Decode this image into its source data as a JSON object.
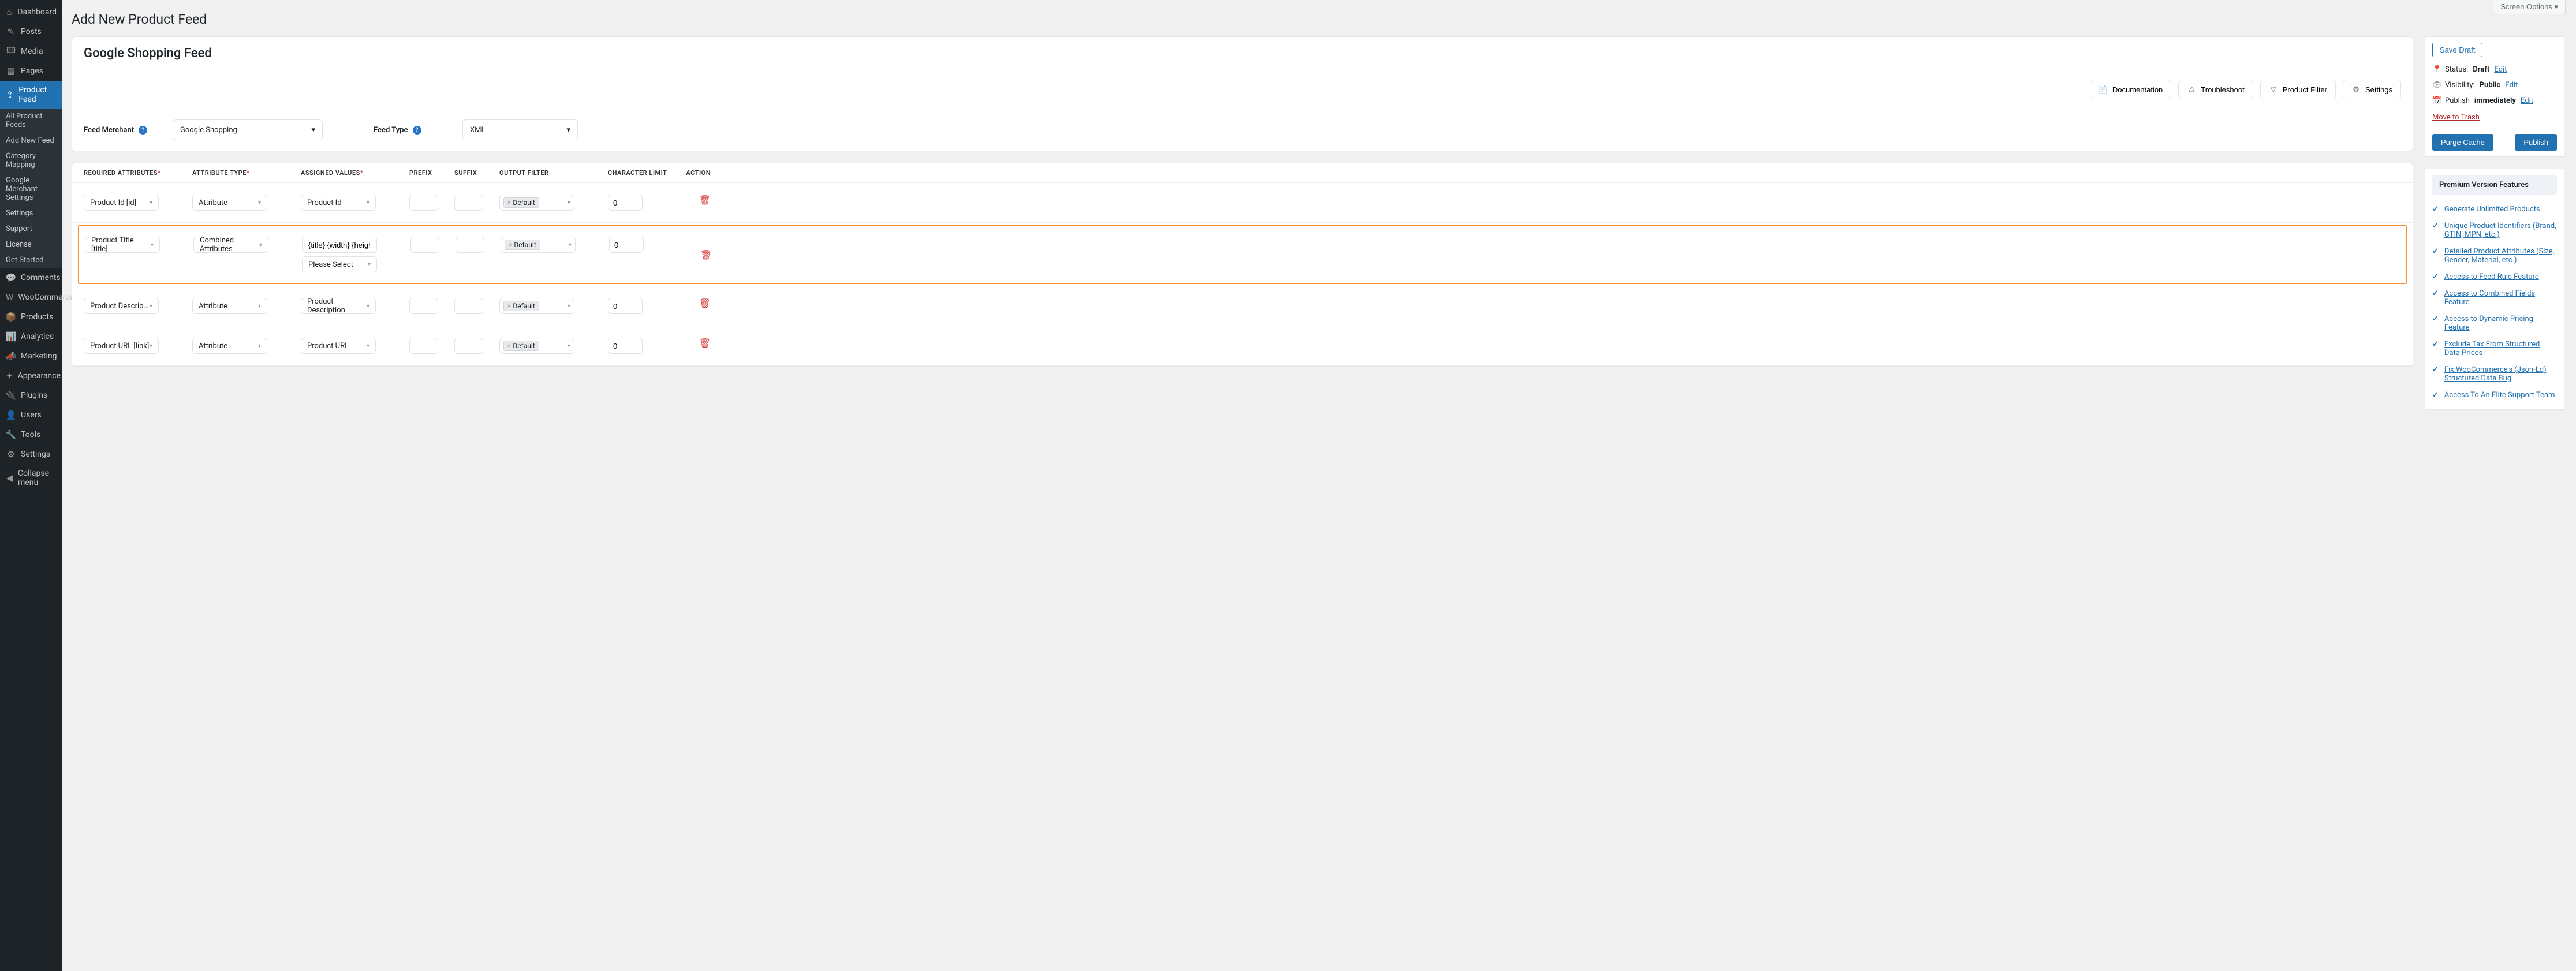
{
  "screen_options": "Screen Options ▾",
  "page_title": "Add New Product Feed",
  "sidebar": {
    "items": [
      {
        "label": "Dashboard",
        "icon": "⌂"
      },
      {
        "label": "Posts",
        "icon": "✎"
      },
      {
        "label": "Media",
        "icon": "🖾"
      },
      {
        "label": "Pages",
        "icon": "▤"
      },
      {
        "label": "Product Feed",
        "icon": "⇪"
      },
      {
        "label": "Comments",
        "icon": "💬"
      },
      {
        "label": "WooCommerce",
        "icon": "W"
      },
      {
        "label": "Products",
        "icon": "📦"
      },
      {
        "label": "Analytics",
        "icon": "📊"
      },
      {
        "label": "Marketing",
        "icon": "📣"
      },
      {
        "label": "Appearance",
        "icon": "✦"
      },
      {
        "label": "Plugins",
        "icon": "🔌"
      },
      {
        "label": "Users",
        "icon": "👤"
      },
      {
        "label": "Tools",
        "icon": "🔧"
      },
      {
        "label": "Settings",
        "icon": "⚙"
      },
      {
        "label": "Collapse menu",
        "icon": "◀"
      }
    ],
    "submenu": [
      "All Product Feeds",
      "Add New Feed",
      "Category Mapping",
      "Google Merchant Settings",
      "Settings",
      "Support",
      "License",
      "Get Started"
    ]
  },
  "panel": {
    "title": "Google Shopping Feed",
    "toolbar": {
      "doc": "Documentation",
      "trouble": "Troubleshoot",
      "filter": "Product Filter",
      "settings": "Settings"
    },
    "merchant_label": "Feed Merchant",
    "merchant_value": "Google Shopping",
    "type_label": "Feed Type",
    "type_value": "XML"
  },
  "table": {
    "headers": {
      "req": "Required Attributes",
      "type": "Attribute Type",
      "assigned": "Assigned Values",
      "prefix": "Prefix",
      "suffix": "Suffix",
      "output": "Output Filter",
      "char": "Character Limit",
      "action": "Action"
    },
    "rows": [
      {
        "req": "Product Id [id]",
        "type": "Attribute",
        "assigned": "Product Id",
        "prefix": "",
        "suffix": "",
        "output": "Default",
        "char": "0"
      },
      {
        "req": "Product Title [title]",
        "type": "Combined Attributes",
        "assigned": "{title} {width} {height}",
        "assigned2": "Please Select",
        "prefix": "",
        "suffix": "",
        "output": "Default",
        "char": "0",
        "highlighted": true
      },
      {
        "req": "Product Description [description]",
        "type": "Attribute",
        "assigned": "Product Description",
        "prefix": "",
        "suffix": "",
        "output": "Default",
        "char": "0"
      },
      {
        "req": "Product URL [link]",
        "type": "Attribute",
        "assigned": "Product URL",
        "prefix": "",
        "suffix": "",
        "output": "Default",
        "char": "0"
      }
    ]
  },
  "publish": {
    "save_draft": "Save Draft",
    "status_label": "Status:",
    "status_value": "Draft",
    "edit": "Edit",
    "visibility_label": "Visibility:",
    "visibility_value": "Public",
    "publish_label": "Publish",
    "publish_value": "immediately",
    "trash": "Move to Trash",
    "purge": "Purge Cache",
    "publish_btn": "Publish"
  },
  "premium": {
    "title": "Premium Version Features",
    "items": [
      "Generate Unlimited Products",
      "Unique Product Identifiers (Brand, GTIN, MPN, etc.)",
      "Detailed Product Attributes (Size, Gender, Material, etc.)",
      "Access to Feed Rule Feature",
      "Access to Combined Fields Feature",
      "Access to Dynamic Pricing Feature",
      "Exclude Tax From Structured Data Prices",
      "Fix WooCommerce's (Json-Ld) Structured Data Bug",
      "Access To An Elite Support Team."
    ]
  }
}
